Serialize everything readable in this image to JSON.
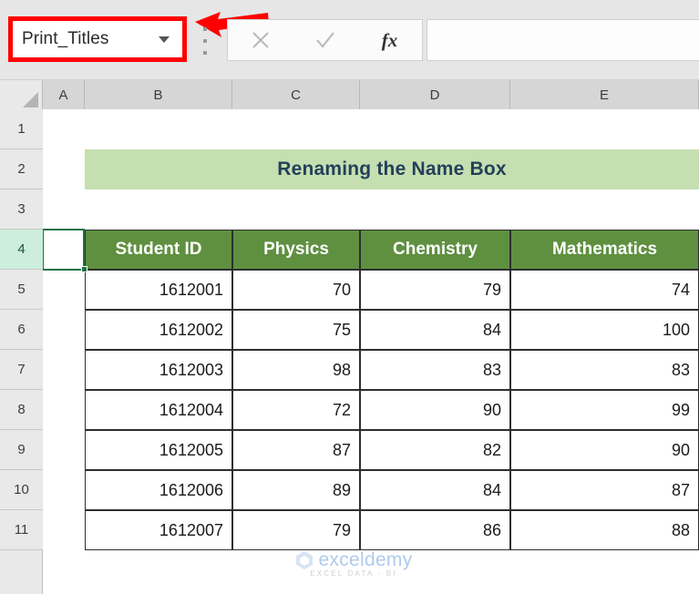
{
  "formula_bar": {
    "name_box": {
      "value": "Print_Titles",
      "dropdown_icon": "chevron-down-icon",
      "highlight_color": "#ff0000"
    },
    "overflow_icon": "vertical-ellipsis-icon",
    "cancel_icon": "cancel-x-icon",
    "enter_icon": "enter-check-icon",
    "insert_function_label": "fx",
    "formula_value": "",
    "annotation_arrow": {
      "icon": "red-arrow-left-icon",
      "color": "#ff0000"
    }
  },
  "grid": {
    "select_all_icon": "select-all-corner-icon",
    "columns": [
      "A",
      "B",
      "C",
      "D",
      "E"
    ],
    "rows": [
      "1",
      "2",
      "3",
      "4",
      "5",
      "6",
      "7",
      "8",
      "9",
      "10",
      "11"
    ],
    "selected_row": "4",
    "selected_cell": "A4",
    "selection_color": "#217346"
  },
  "sheet": {
    "banner_title": "Renaming the Name Box",
    "banner_color": "#c6dfb0",
    "table": {
      "header_color": "#5f9040",
      "headers": [
        "Student ID",
        "Physics",
        "Chemistry",
        "Mathematics"
      ],
      "rows": [
        [
          "1612001",
          "70",
          "79",
          "74"
        ],
        [
          "1612002",
          "75",
          "84",
          "100"
        ],
        [
          "1612003",
          "98",
          "83",
          "83"
        ],
        [
          "1612004",
          "72",
          "90",
          "99"
        ],
        [
          "1612005",
          "87",
          "82",
          "90"
        ],
        [
          "1612006",
          "89",
          "84",
          "87"
        ],
        [
          "1612007",
          "79",
          "86",
          "88"
        ]
      ]
    }
  },
  "watermark": {
    "name": "exceldemy",
    "tagline": "EXCEL  DATA - BI",
    "icon": "exceldemy-logo-icon"
  }
}
